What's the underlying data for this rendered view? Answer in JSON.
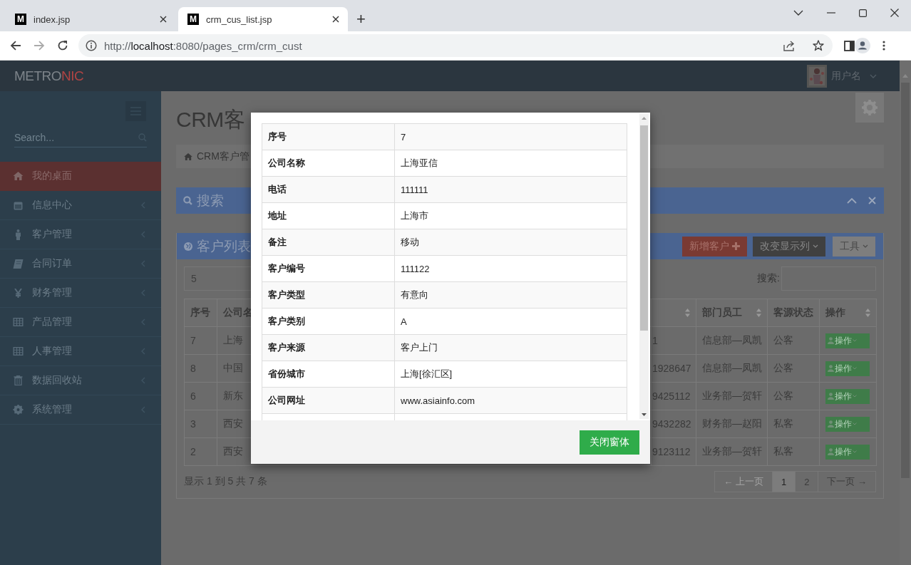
{
  "browser": {
    "tabs": [
      {
        "favicon": "M",
        "title": "index.jsp",
        "selected": false
      },
      {
        "favicon": "M",
        "title": "crm_cus_list.jsp",
        "selected": true
      }
    ],
    "new_tab": "+",
    "url": {
      "scheme": "http://",
      "host": "localhost",
      "path": ":8080/pages_crm/crm_cust"
    }
  },
  "header": {
    "logo": [
      {
        "text": "METRO",
        "accent": false
      },
      {
        "text": "NIC",
        "accent": true
      }
    ],
    "user": "用户名"
  },
  "sidebar": {
    "search_placeholder": "Search...",
    "items": [
      {
        "label": "我的桌面",
        "selected": true,
        "submenu": false
      },
      {
        "label": "信息中心",
        "selected": false,
        "submenu": true
      },
      {
        "label": "客户管理",
        "selected": false,
        "submenu": true
      },
      {
        "label": "合同订单",
        "selected": false,
        "submenu": true
      },
      {
        "label": "财务管理",
        "selected": false,
        "submenu": true
      },
      {
        "label": "产品管理",
        "selected": false,
        "submenu": true
      },
      {
        "label": "人事管理",
        "selected": false,
        "submenu": true
      },
      {
        "label": "数据回收站",
        "selected": false,
        "submenu": true
      },
      {
        "label": "系统管理",
        "selected": false,
        "submenu": true
      }
    ]
  },
  "page": {
    "title": "CRM客",
    "breadcrumb": "CRM客户管",
    "search_panel": {
      "title": "搜索"
    },
    "list_panel": {
      "title": "客户列表",
      "buttons": [
        {
          "label": "新增客户",
          "kind": "add"
        },
        {
          "label": "改变显示列",
          "kind": "dark"
        },
        {
          "label": "工具",
          "kind": "light"
        }
      ],
      "page_size": "5",
      "search_label": "搜索:",
      "table": {
        "columns": [
          {
            "label": "序号"
          },
          {
            "label": "公司名"
          },
          {
            "sortable": true
          },
          {
            "label": "部门员工",
            "sortable": true
          },
          {
            "label": "客源状态"
          },
          {
            "label": "操作",
            "sortable": true
          }
        ],
        "rows": [
          [
            "7",
            "上海",
            "1",
            "信息部—凤凯",
            "公客",
            "操作"
          ],
          [
            "8",
            "中国",
            "1928647",
            "信息部—凤凯",
            "公客",
            "操作"
          ],
          [
            "6",
            "新东",
            "9425112",
            "业务部—贺轩",
            "公客",
            "操作"
          ],
          [
            "3",
            "西安",
            "9432282",
            "财务部—赵阳",
            "私客",
            "操作"
          ],
          [
            "2",
            "西安",
            "9123112",
            "业务部—贺轩",
            "私客",
            "操作"
          ]
        ]
      },
      "info": "显示 1 到 5 共 7 条",
      "pagination": [
        {
          "label": "← 上一页",
          "disabled": true,
          "selected": false
        },
        {
          "label": "1",
          "disabled": false,
          "selected": true
        },
        {
          "label": "2",
          "disabled": false,
          "selected": false
        },
        {
          "label": "下一页 →",
          "disabled": false,
          "selected": false
        }
      ]
    }
  },
  "modal": {
    "fields": [
      {
        "label": "序号",
        "value": "7"
      },
      {
        "label": "公司名称",
        "value": "上海亚信"
      },
      {
        "label": "电话",
        "value": "111111"
      },
      {
        "label": "地址",
        "value": "上海市"
      },
      {
        "label": "备注",
        "value": "移动"
      },
      {
        "label": "客户编号",
        "value": "111122"
      },
      {
        "label": "客户类型",
        "value": "有意向"
      },
      {
        "label": "客户类别",
        "value": "A"
      },
      {
        "label": "客户来源",
        "value": "客户上门"
      },
      {
        "label": "省份城市",
        "value": "上海[徐汇区]"
      },
      {
        "label": "公司网址",
        "value": "www.asiainfo.com"
      }
    ],
    "close_button": "关闭窗体"
  }
}
